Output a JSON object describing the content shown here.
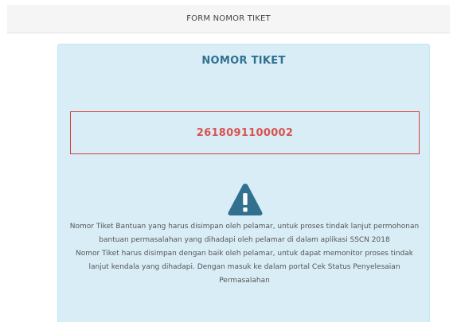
{
  "header": {
    "title": "FORM NOMOR TIKET"
  },
  "card": {
    "heading": "NOMOR TIKET",
    "ticket_number": "2618091100002",
    "icon": "warning-triangle-icon",
    "message_1": "Nomor Tiket Bantuan yang harus disimpan oleh pelamar, untuk proses tindak lanjut permohonan bantuan permasalahan yang dihadapi oleh pelamar di dalam aplikasi SSCN 2018",
    "message_2": "Nomor Tiket harus disimpan dengan baik oleh pelamar, untuk dapat memonitor proses tindak lanjut kendala yang dihadapi. Dengan masuk ke dalam portal Cek Status Penyelesaian Permasalahan"
  },
  "colors": {
    "card_background": "#d9edf7",
    "heading": "#31708f",
    "ticket_number": "#d9534f",
    "ticket_border": "#d43f3a",
    "icon": "#31708f"
  }
}
